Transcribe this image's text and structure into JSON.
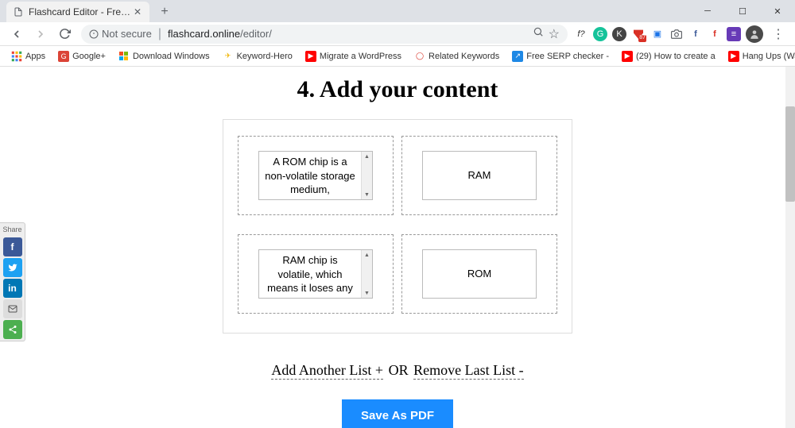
{
  "tab": {
    "title": "Flashcard Editor - Free online app"
  },
  "address": {
    "not_secure": "Not secure",
    "host": "flashcard.online",
    "path": "/editor/"
  },
  "bookmarks": {
    "apps": "Apps",
    "items": [
      {
        "label": "Google+",
        "bg": "#db4437",
        "glyph": "G"
      },
      {
        "label": "Download Windows",
        "bg": "",
        "glyph": ""
      },
      {
        "label": "Keyword-Hero",
        "bg": "#f0b400",
        "glyph": "✈"
      },
      {
        "label": "Migrate a WordPress",
        "bg": "#ff0000",
        "glyph": "▶"
      },
      {
        "label": "Related Keywords",
        "bg": "",
        "glyph": "◯"
      },
      {
        "label": "Free SERP checker - ",
        "bg": "#1e88e5",
        "glyph": "↗"
      },
      {
        "label": "(29) How to create a",
        "bg": "#ff0000",
        "glyph": "▶"
      },
      {
        "label": "Hang Ups (Want You",
        "bg": "#ff0000",
        "glyph": "▶"
      }
    ]
  },
  "ext_badge": "87",
  "heading": "4. Add your content",
  "cards": [
    {
      "left": "A ROM chip is a non-volatile storage medium,",
      "right": "RAM"
    },
    {
      "left": "RAM chip is volatile, which means it loses any",
      "right": "ROM"
    }
  ],
  "actions": {
    "add": "Add Another List +",
    "or": "OR",
    "remove": "Remove Last List -",
    "save": "Save As PDF"
  },
  "share": {
    "title": "Share"
  }
}
